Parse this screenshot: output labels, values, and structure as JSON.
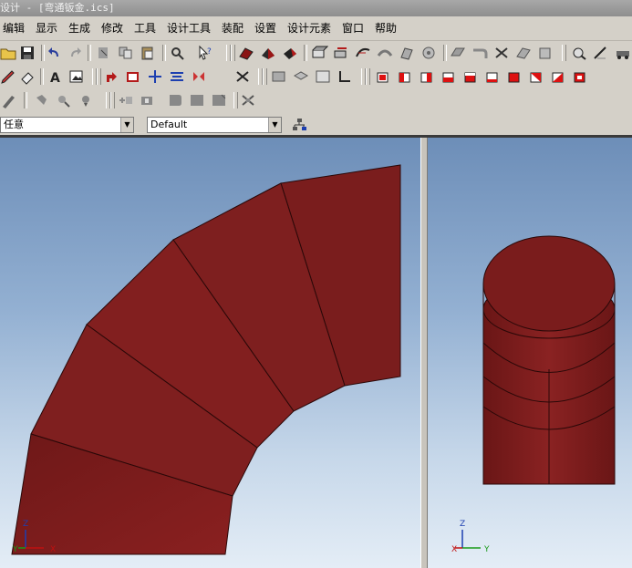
{
  "window": {
    "title": "设计 - [弯通钣金.ics]"
  },
  "menu": [
    "编辑",
    "显示",
    "生成",
    "修改",
    "工具",
    "设计工具",
    "装配",
    "设置",
    "设计元素",
    "窗口",
    "帮助"
  ],
  "selectors": {
    "filter_value": "任意",
    "style_value": "Default"
  },
  "axes_left": {
    "z": "Z",
    "y": "Y",
    "x": "X"
  },
  "axes_right": {
    "z": "Z",
    "x": "X",
    "y": "Y"
  },
  "colors": {
    "part": "#7e1e1e",
    "part_dark": "#5c1414",
    "edge": "#2a0808"
  }
}
